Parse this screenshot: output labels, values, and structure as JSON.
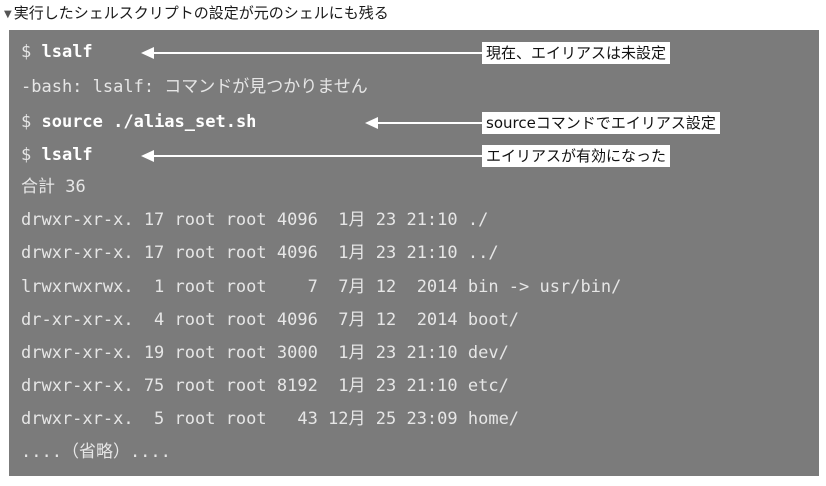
{
  "caption": {
    "marker": "▼",
    "text": "実行したシェルスクリプトの設定が元のシェルにも残る"
  },
  "terminal": {
    "lines": [
      {
        "prompt": "$ ",
        "command": "lsalf"
      },
      {
        "text": "-bash: lsalf: コマンドが見つかりません"
      },
      {
        "prompt": "$ ",
        "command": "source ./alias_set.sh"
      },
      {
        "prompt": "$ ",
        "command": "lsalf"
      },
      {
        "text": "合計 36"
      },
      {
        "text": "drwxr-xr-x. 17 root root 4096  1月 23 21:10 ./"
      },
      {
        "text": "drwxr-xr-x. 17 root root 4096  1月 23 21:10 ../"
      },
      {
        "text": "lrwxrwxrwx.  1 root root    7  7月 12  2014 bin -> usr/bin/"
      },
      {
        "text": "dr-xr-xr-x.  4 root root 4096  7月 12  2014 boot/"
      },
      {
        "text": "drwxr-xr-x. 19 root root 3000  1月 23 21:10 dev/"
      },
      {
        "text": "drwxr-xr-x. 75 root root 8192  1月 23 21:10 etc/"
      },
      {
        "text": "drwxr-xr-x.  5 root root   43 12月 25 23:09 home/"
      },
      {
        "text": "....（省略）...."
      }
    ]
  },
  "annotations": [
    {
      "text": "現在、エイリアスは未設定"
    },
    {
      "text": "sourceコマンドでエイリアス設定"
    },
    {
      "text": "エイリアスが有効になった"
    }
  ]
}
